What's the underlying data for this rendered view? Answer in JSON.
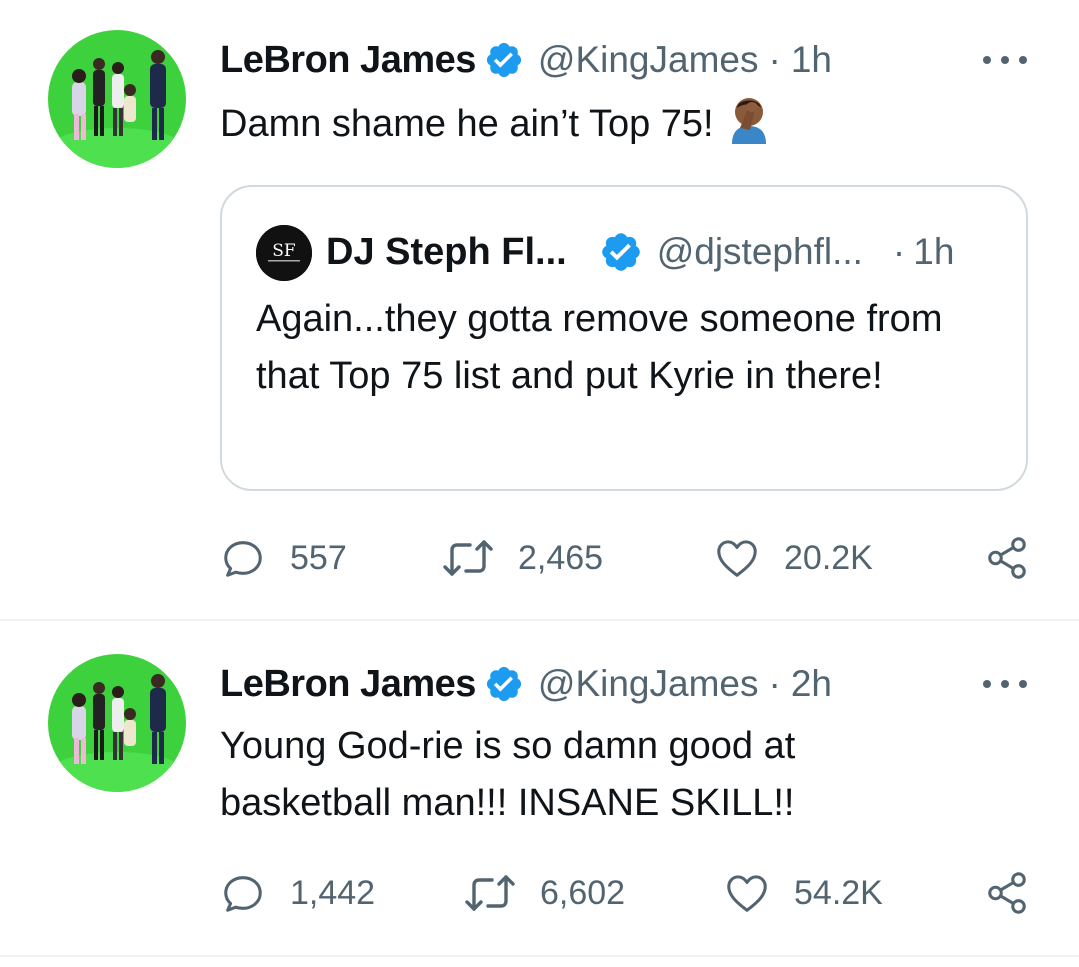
{
  "tweets": [
    {
      "author_name": "LeBron James",
      "handle": "@KingJames",
      "time": "1h",
      "text": "Damn shame he ain’t Top 75!",
      "emoji": "man-facepalming",
      "quote": {
        "avatar_text": "SF",
        "author_name": "DJ Steph Fl...",
        "handle": "@djstephfl...",
        "time": "1h",
        "text": "Again...they gotta remove someone from that Top 75 list and put Kyrie in there!"
      },
      "replies": "557",
      "retweets": "2,465",
      "likes": "20.2K"
    },
    {
      "author_name": "LeBron James",
      "handle": "@KingJames",
      "time": "2h",
      "text_line1": "Young God-rie is so damn good at",
      "text_line2": "basketball man!!! INSANE SKILL!!",
      "replies": "1,442",
      "retweets": "6,602",
      "likes": "54.2K"
    }
  ],
  "colors": {
    "verified": "#1d9bf0",
    "secondary_text": "#536471",
    "border": "#cfd9de",
    "avatar_green": "#3cd43c"
  },
  "icons": {
    "verified": "verified-badge-icon",
    "reply": "reply-icon",
    "retweet": "retweet-icon",
    "like": "heart-icon",
    "share": "share-icon",
    "more": "more-options-icon"
  }
}
